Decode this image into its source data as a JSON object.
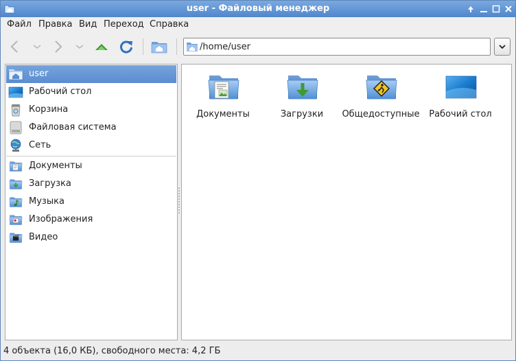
{
  "window": {
    "title": "user - Файловый менеджер",
    "accent_color": "#5b8dd0"
  },
  "menubar": {
    "items": [
      {
        "label": "Файл"
      },
      {
        "label": "Правка"
      },
      {
        "label": "Вид"
      },
      {
        "label": "Переход"
      },
      {
        "label": "Справка"
      }
    ]
  },
  "toolbar": {
    "buttons": [
      {
        "icon": "back-arrow-icon"
      },
      {
        "icon": "chevron-down-icon"
      },
      {
        "icon": "forward-arrow-icon"
      },
      {
        "icon": "chevron-down-icon"
      },
      {
        "icon": "up-arrow-icon"
      },
      {
        "icon": "reload-icon"
      },
      {
        "icon": "home-folder-icon"
      }
    ],
    "address": "/home/user"
  },
  "sidebar": {
    "places": [
      {
        "label": "user",
        "icon": "home-folder-icon",
        "selected": true
      },
      {
        "label": "Рабочий стол",
        "icon": "desktop-icon"
      },
      {
        "label": "Корзина",
        "icon": "trash-icon"
      },
      {
        "label": "Файловая система",
        "icon": "hard-drive-icon"
      },
      {
        "label": "Сеть",
        "icon": "network-globe-icon"
      }
    ],
    "bookmarks": [
      {
        "label": "Документы",
        "icon": "documents-folder-icon"
      },
      {
        "label": "Загрузка",
        "icon": "downloads-folder-icon"
      },
      {
        "label": "Музыка",
        "icon": "music-folder-icon"
      },
      {
        "label": "Изображения",
        "icon": "pictures-folder-icon"
      },
      {
        "label": "Видео",
        "icon": "video-folder-icon"
      }
    ]
  },
  "files": [
    {
      "label": "Документы",
      "icon": "documents-folder-icon"
    },
    {
      "label": "Загрузки",
      "icon": "downloads-folder-icon"
    },
    {
      "label": "Общедоступные",
      "icon": "public-folder-icon"
    },
    {
      "label": "Рабочий стол",
      "icon": "desktop-icon"
    }
  ],
  "status": {
    "text": "4 объекта (16,0 КБ), свободного места: 4,2 ГБ"
  }
}
